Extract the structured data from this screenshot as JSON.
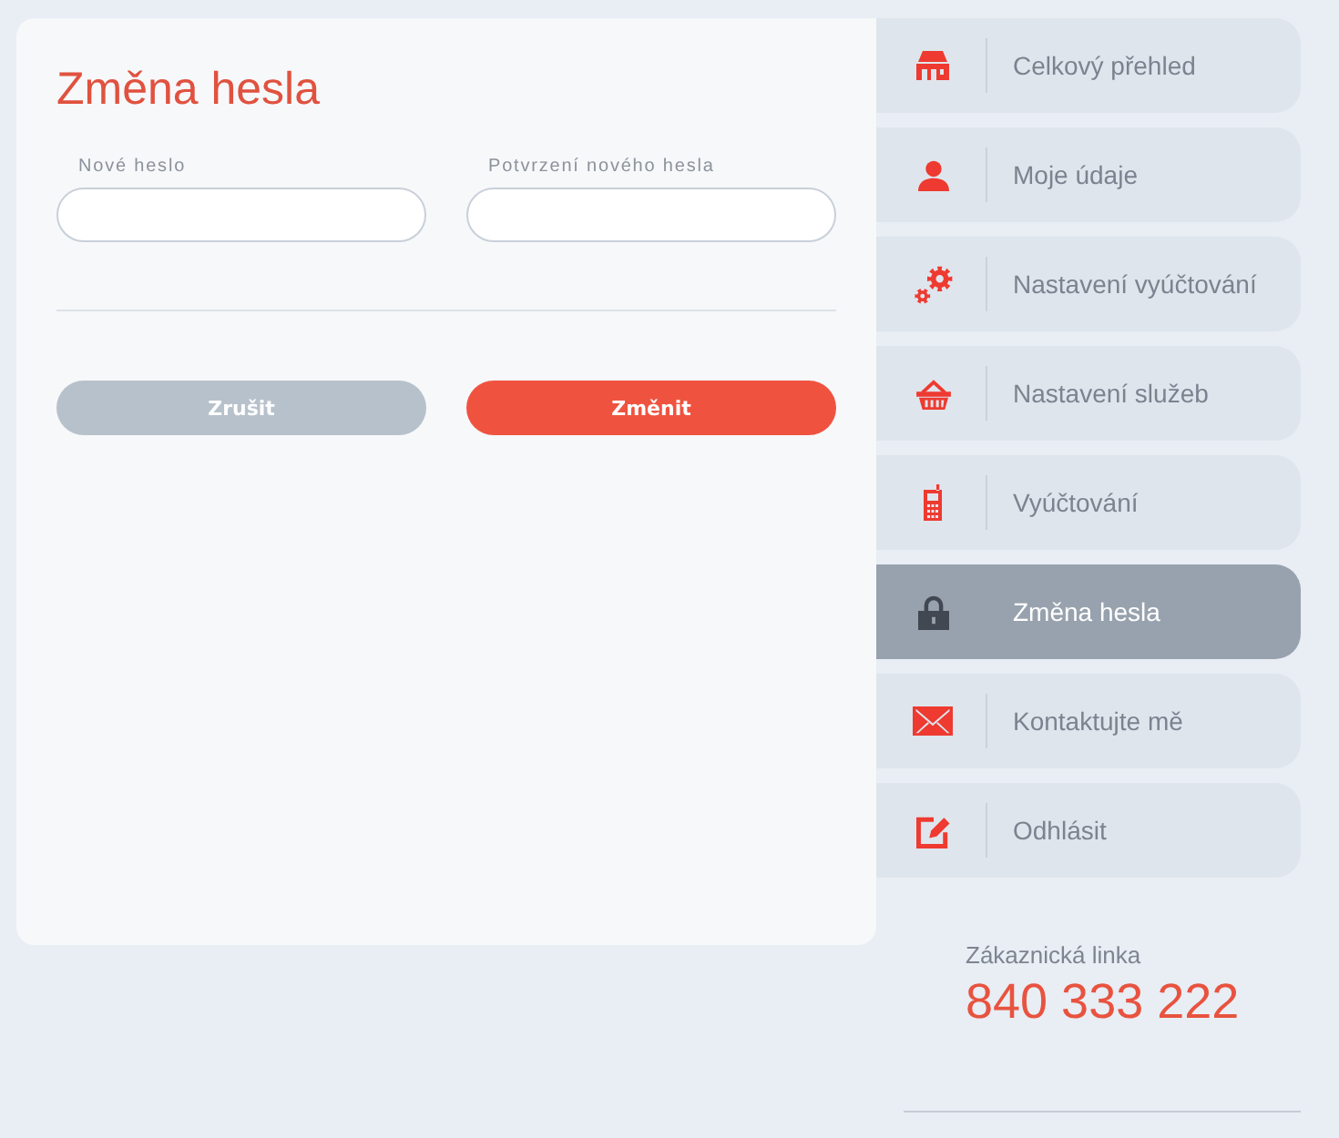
{
  "page_title": "Změna hesla",
  "fields": [
    {
      "label": "Nové heslo"
    },
    {
      "label": "Potvrzení nového hesla"
    }
  ],
  "buttons": [
    {
      "label": "Zrušit",
      "kind": "secondary"
    },
    {
      "label": "Změnit",
      "kind": "primary"
    }
  ],
  "sidebar": {
    "items": [
      {
        "label": "Celkový přehled",
        "selected": false
      },
      {
        "label": "Moje údaje",
        "selected": false
      },
      {
        "label": "Nastavení vyúčtování",
        "selected": false
      },
      {
        "label": "Nastavení služeb",
        "selected": false
      },
      {
        "label": "Vyúčtování",
        "selected": false
      },
      {
        "label": "Změna hesla",
        "selected": true
      },
      {
        "label": "Kontaktujte mě",
        "selected": false
      },
      {
        "label": "Odhlásit",
        "selected": false
      }
    ]
  },
  "hotline": {
    "label": "Zákaznická linka",
    "number": "840 333 222"
  }
}
